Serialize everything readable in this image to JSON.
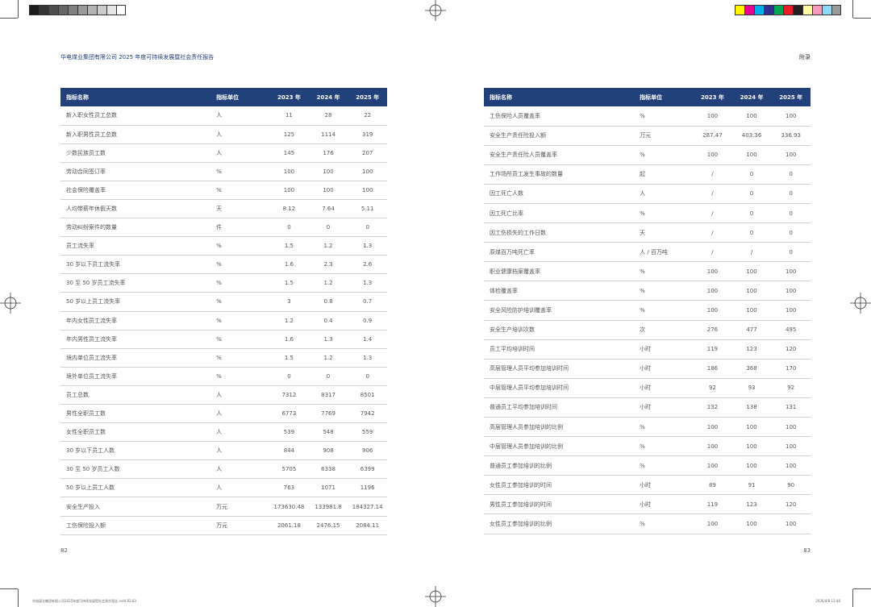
{
  "header": {
    "left_title": "华电煤业集团有限公司 2025 年度可持续发展暨社会责任报告",
    "right_title": "附录"
  },
  "colors": {
    "table_header_bg": "#22407a",
    "row_border": "#cfcfcf",
    "grayscale_bar": [
      "#1a1a1a",
      "#333333",
      "#4d4d4d",
      "#666666",
      "#808080",
      "#999999",
      "#b3b3b3",
      "#cccccc",
      "#e6e6e6",
      "#ffffff"
    ],
    "color_bar": [
      "#fff200",
      "#ec008c",
      "#00aeef",
      "#2e3192",
      "#00a651",
      "#ed1c24",
      "#231f20",
      "#fff9a6",
      "#f49ac1",
      "#8ed8f8",
      "#999999"
    ]
  },
  "left_table": {
    "headers": [
      "指标名称",
      "指标单位",
      "2023 年",
      "2024 年",
      "2025 年"
    ],
    "rows": [
      [
        "新入职女性员工总数",
        "人",
        "11",
        "28",
        "22"
      ],
      [
        "新入职男性员工总数",
        "人",
        "125",
        "1114",
        "319"
      ],
      [
        "少数民族员工数",
        "人",
        "145",
        "176",
        "207"
      ],
      [
        "劳动合同签订率",
        "%",
        "100",
        "100",
        "100"
      ],
      [
        "社会保险覆盖率",
        "%",
        "100",
        "100",
        "100"
      ],
      [
        "人均带薪年休假天数",
        "天",
        "8.12",
        "7.64",
        "5.11"
      ],
      [
        "劳动纠纷案件的数量",
        "件",
        "0",
        "0",
        "0"
      ],
      [
        "员工流失率",
        "%",
        "1.5",
        "1.2",
        "1.3"
      ],
      [
        "30 岁以下员工流失率",
        "%",
        "1.6",
        "2.3",
        "2.6"
      ],
      [
        "30 至 50 岁员工流失率",
        "%",
        "1.5",
        "1.2",
        "1.3"
      ],
      [
        "50 岁以上员工流失率",
        "%",
        "3",
        "0.8",
        "0.7"
      ],
      [
        "年内女性员工流失率",
        "%",
        "1.2",
        "0.4",
        "0.9"
      ],
      [
        "年内男性员工流失率",
        "%",
        "1.6",
        "1.3",
        "1.4"
      ],
      [
        "境内单位员工流失率",
        "%",
        "1.5",
        "1.2",
        "1.3"
      ],
      [
        "境外单位员工流失率",
        "%",
        "0",
        "0",
        "0"
      ],
      [
        "员工总数",
        "人",
        "7312",
        "8317",
        "8501"
      ],
      [
        "男性全职员工数",
        "人",
        "6773",
        "7769",
        "7942"
      ],
      [
        "女性全职员工数",
        "人",
        "539",
        "548",
        "559"
      ],
      [
        "30 岁以下员工人数",
        "人",
        "844",
        "908",
        "906"
      ],
      [
        "30 至 50 岁员工人数",
        "人",
        "5705",
        "6338",
        "6399"
      ],
      [
        "50 岁以上员工人数",
        "人",
        "763",
        "1071",
        "1196"
      ],
      [
        "安全生产投入",
        "万元",
        "173630.48",
        "133981.8",
        "184327.14"
      ],
      [
        "工伤保险投入额",
        "万元",
        "2061.18",
        "2476.15",
        "2084.11"
      ]
    ]
  },
  "right_table": {
    "headers": [
      "指标名称",
      "指标单位",
      "2023 年",
      "2024 年",
      "2025 年"
    ],
    "rows": [
      [
        "工伤保险人员覆盖率",
        "%",
        "100",
        "100",
        "100"
      ],
      [
        "安全生产责任险投入额",
        "万元",
        "287.47",
        "403.36",
        "336.93"
      ],
      [
        "安全生产责任险人员覆盖率",
        "%",
        "100",
        "100",
        "100"
      ],
      [
        "工作场所员工发生事故的数量",
        "起",
        "/",
        "0",
        "0"
      ],
      [
        "因工死亡人数",
        "人",
        "/",
        "0",
        "0"
      ],
      [
        "因工死亡比率",
        "%",
        "/",
        "0",
        "0"
      ],
      [
        "因工伤损失的工作日数",
        "天",
        "/",
        "0",
        "0"
      ],
      [
        "原煤百万吨死亡率",
        "人 / 百万吨",
        "/",
        "/",
        "0"
      ],
      [
        "职业健康档案覆盖率",
        "%",
        "100",
        "100",
        "100"
      ],
      [
        "体检覆盖率",
        "%",
        "100",
        "100",
        "100"
      ],
      [
        "安全风险防护培训覆盖率",
        "%",
        "100",
        "100",
        "100"
      ],
      [
        "安全生产培训次数",
        "次",
        "276",
        "477",
        "495"
      ],
      [
        "员工平均培训时间",
        "小时",
        "119",
        "123",
        "120"
      ],
      [
        "高层管理人员平均参加培训时间",
        "小时",
        "186",
        "368",
        "170"
      ],
      [
        "中层管理人员平均参加培训时间",
        "小时",
        "92",
        "93",
        "92"
      ],
      [
        "普通员工平均参加培训时间",
        "小时",
        "132",
        "138",
        "131"
      ],
      [
        "高层管理人员参加培训的比例",
        "%",
        "100",
        "100",
        "100"
      ],
      [
        "中层管理人员参加培训的比例",
        "%",
        "100",
        "100",
        "100"
      ],
      [
        "普通员工参加培训的比例",
        "%",
        "100",
        "100",
        "100"
      ],
      [
        "女性员工参加培训的时间",
        "小时",
        "89",
        "91",
        "90"
      ],
      [
        "男性员工参加培训的时间",
        "小时",
        "119",
        "123",
        "120"
      ],
      [
        "女性员工参加培训的比例",
        "%",
        "100",
        "100",
        "100"
      ]
    ]
  },
  "footer": {
    "page_left": "82",
    "page_right": "83",
    "slug_left": "华电煤业集团有限公司2025年度可持续发展暨社会责任报告.indd 82-83",
    "slug_right": "2026/4/8 12:46"
  }
}
